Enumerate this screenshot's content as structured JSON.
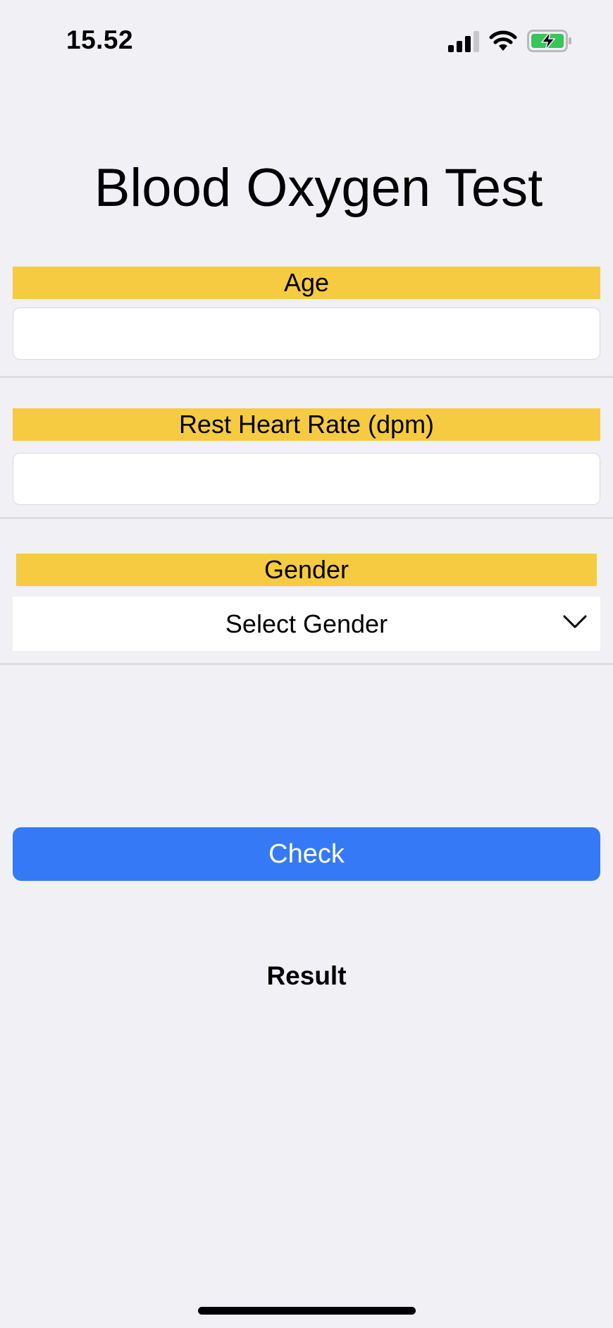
{
  "status_bar": {
    "time": "15.52",
    "signal_icon": "cellular-signal-icon",
    "wifi_icon": "wifi-icon",
    "battery_icon": "battery-charging-icon",
    "battery_color": "#34c759"
  },
  "page": {
    "title": "Blood Oxygen Test"
  },
  "form": {
    "age": {
      "label": "Age",
      "value": "",
      "placeholder": ""
    },
    "heart_rate": {
      "label": "Rest Heart Rate (dpm)",
      "value": "",
      "placeholder": ""
    },
    "gender": {
      "label": "Gender",
      "selected": "Select Gender",
      "icon": "chevron-down-icon"
    },
    "label_color": "#f6cb42"
  },
  "actions": {
    "check_label": "Check",
    "check_color": "#3579f6"
  },
  "result": {
    "label": "Result"
  }
}
